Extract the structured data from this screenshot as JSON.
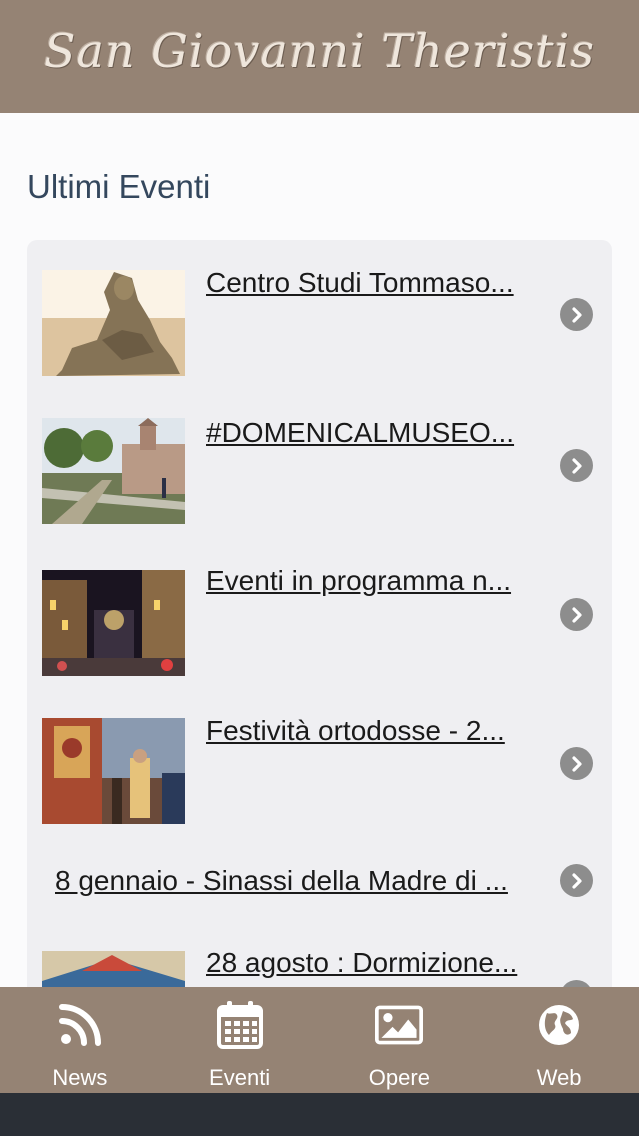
{
  "header": {
    "logo_text": "San Giovanni Theristis"
  },
  "section": {
    "title": "Ultimi Eventi"
  },
  "events": [
    {
      "title": "Centro Studi Tommaso...",
      "thumb": "statue-thumbnail"
    },
    {
      "title": "#DOMENICALMUSEO...",
      "thumb": "church-thumbnail"
    },
    {
      "title": "Eventi in programma n...",
      "thumb": "street-night-thumbnail"
    },
    {
      "title": "Festività ortodosse - 2...",
      "thumb": "icon-ceremony-thumbnail"
    },
    {
      "title": "8 gennaio - Sinassi della Madre di ...",
      "thumb": null
    },
    {
      "title": "28 agosto : Dormizione...",
      "thumb": "fresco-thumbnail"
    }
  ],
  "tabs": [
    {
      "label": "News",
      "icon": "rss-icon"
    },
    {
      "label": "Eventi",
      "icon": "calendar-icon"
    },
    {
      "label": "Opere",
      "icon": "image-icon"
    },
    {
      "label": "Web",
      "icon": "globe-icon"
    }
  ],
  "colors": {
    "header_bg": "#958374",
    "title_color": "#34475d",
    "card_bg": "#efeff2",
    "chevron_bg": "#8d8d8d",
    "bottom_bar": "#2a2f36"
  }
}
